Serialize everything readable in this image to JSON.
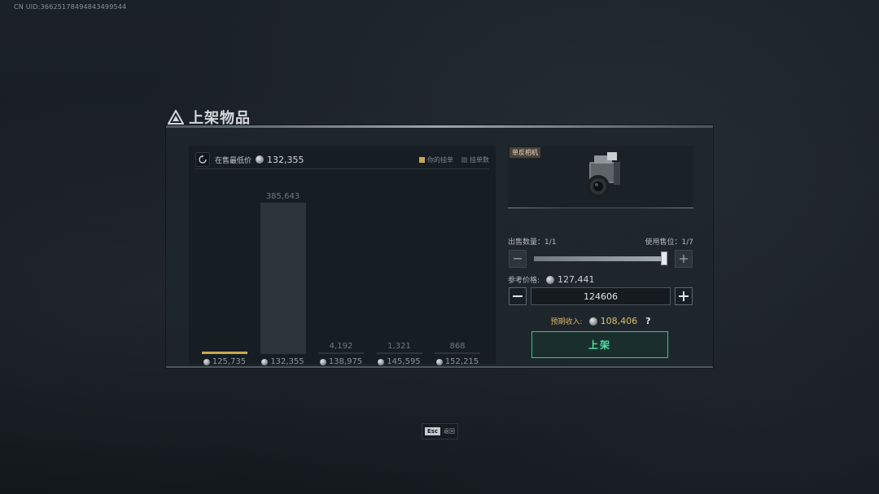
{
  "uid": "CN UID:36625178494843499544",
  "dialog": {
    "title": "上架物品"
  },
  "market": {
    "lowest_label": "在售最低价",
    "lowest_price": "132,355",
    "legend": [
      {
        "label": "你的挂单",
        "color": "#c9a84e"
      },
      {
        "label": "挂单数",
        "color": "#3c474d"
      }
    ],
    "bars": [
      {
        "price": "125,735",
        "count": "",
        "relative_height": 0.0,
        "mine": true
      },
      {
        "price": "132,355",
        "count": "385,643",
        "relative_height": 1.0,
        "mine": false
      },
      {
        "price": "138,975",
        "count": "4,192",
        "relative_height": 0.01,
        "mine": false
      },
      {
        "price": "145,595",
        "count": "1,321",
        "relative_height": 0.01,
        "mine": false
      },
      {
        "price": "152,215",
        "count": "868",
        "relative_height": 0.01,
        "mine": false
      }
    ]
  },
  "item": {
    "tag": "单反相机",
    "icon": "camera-icon"
  },
  "sell": {
    "qty_label": "出售数量：1/1",
    "slot_label": "使用售位：1/7",
    "slider_fraction": 1.0,
    "ref_label": "参考价格:",
    "ref_price": "127,441",
    "price_value": "124606",
    "income_label": "预期收入:",
    "income_value": "108,406",
    "help": "?",
    "submit_label": "上架"
  },
  "footer": {
    "key": "Esc",
    "label": "返回"
  }
}
